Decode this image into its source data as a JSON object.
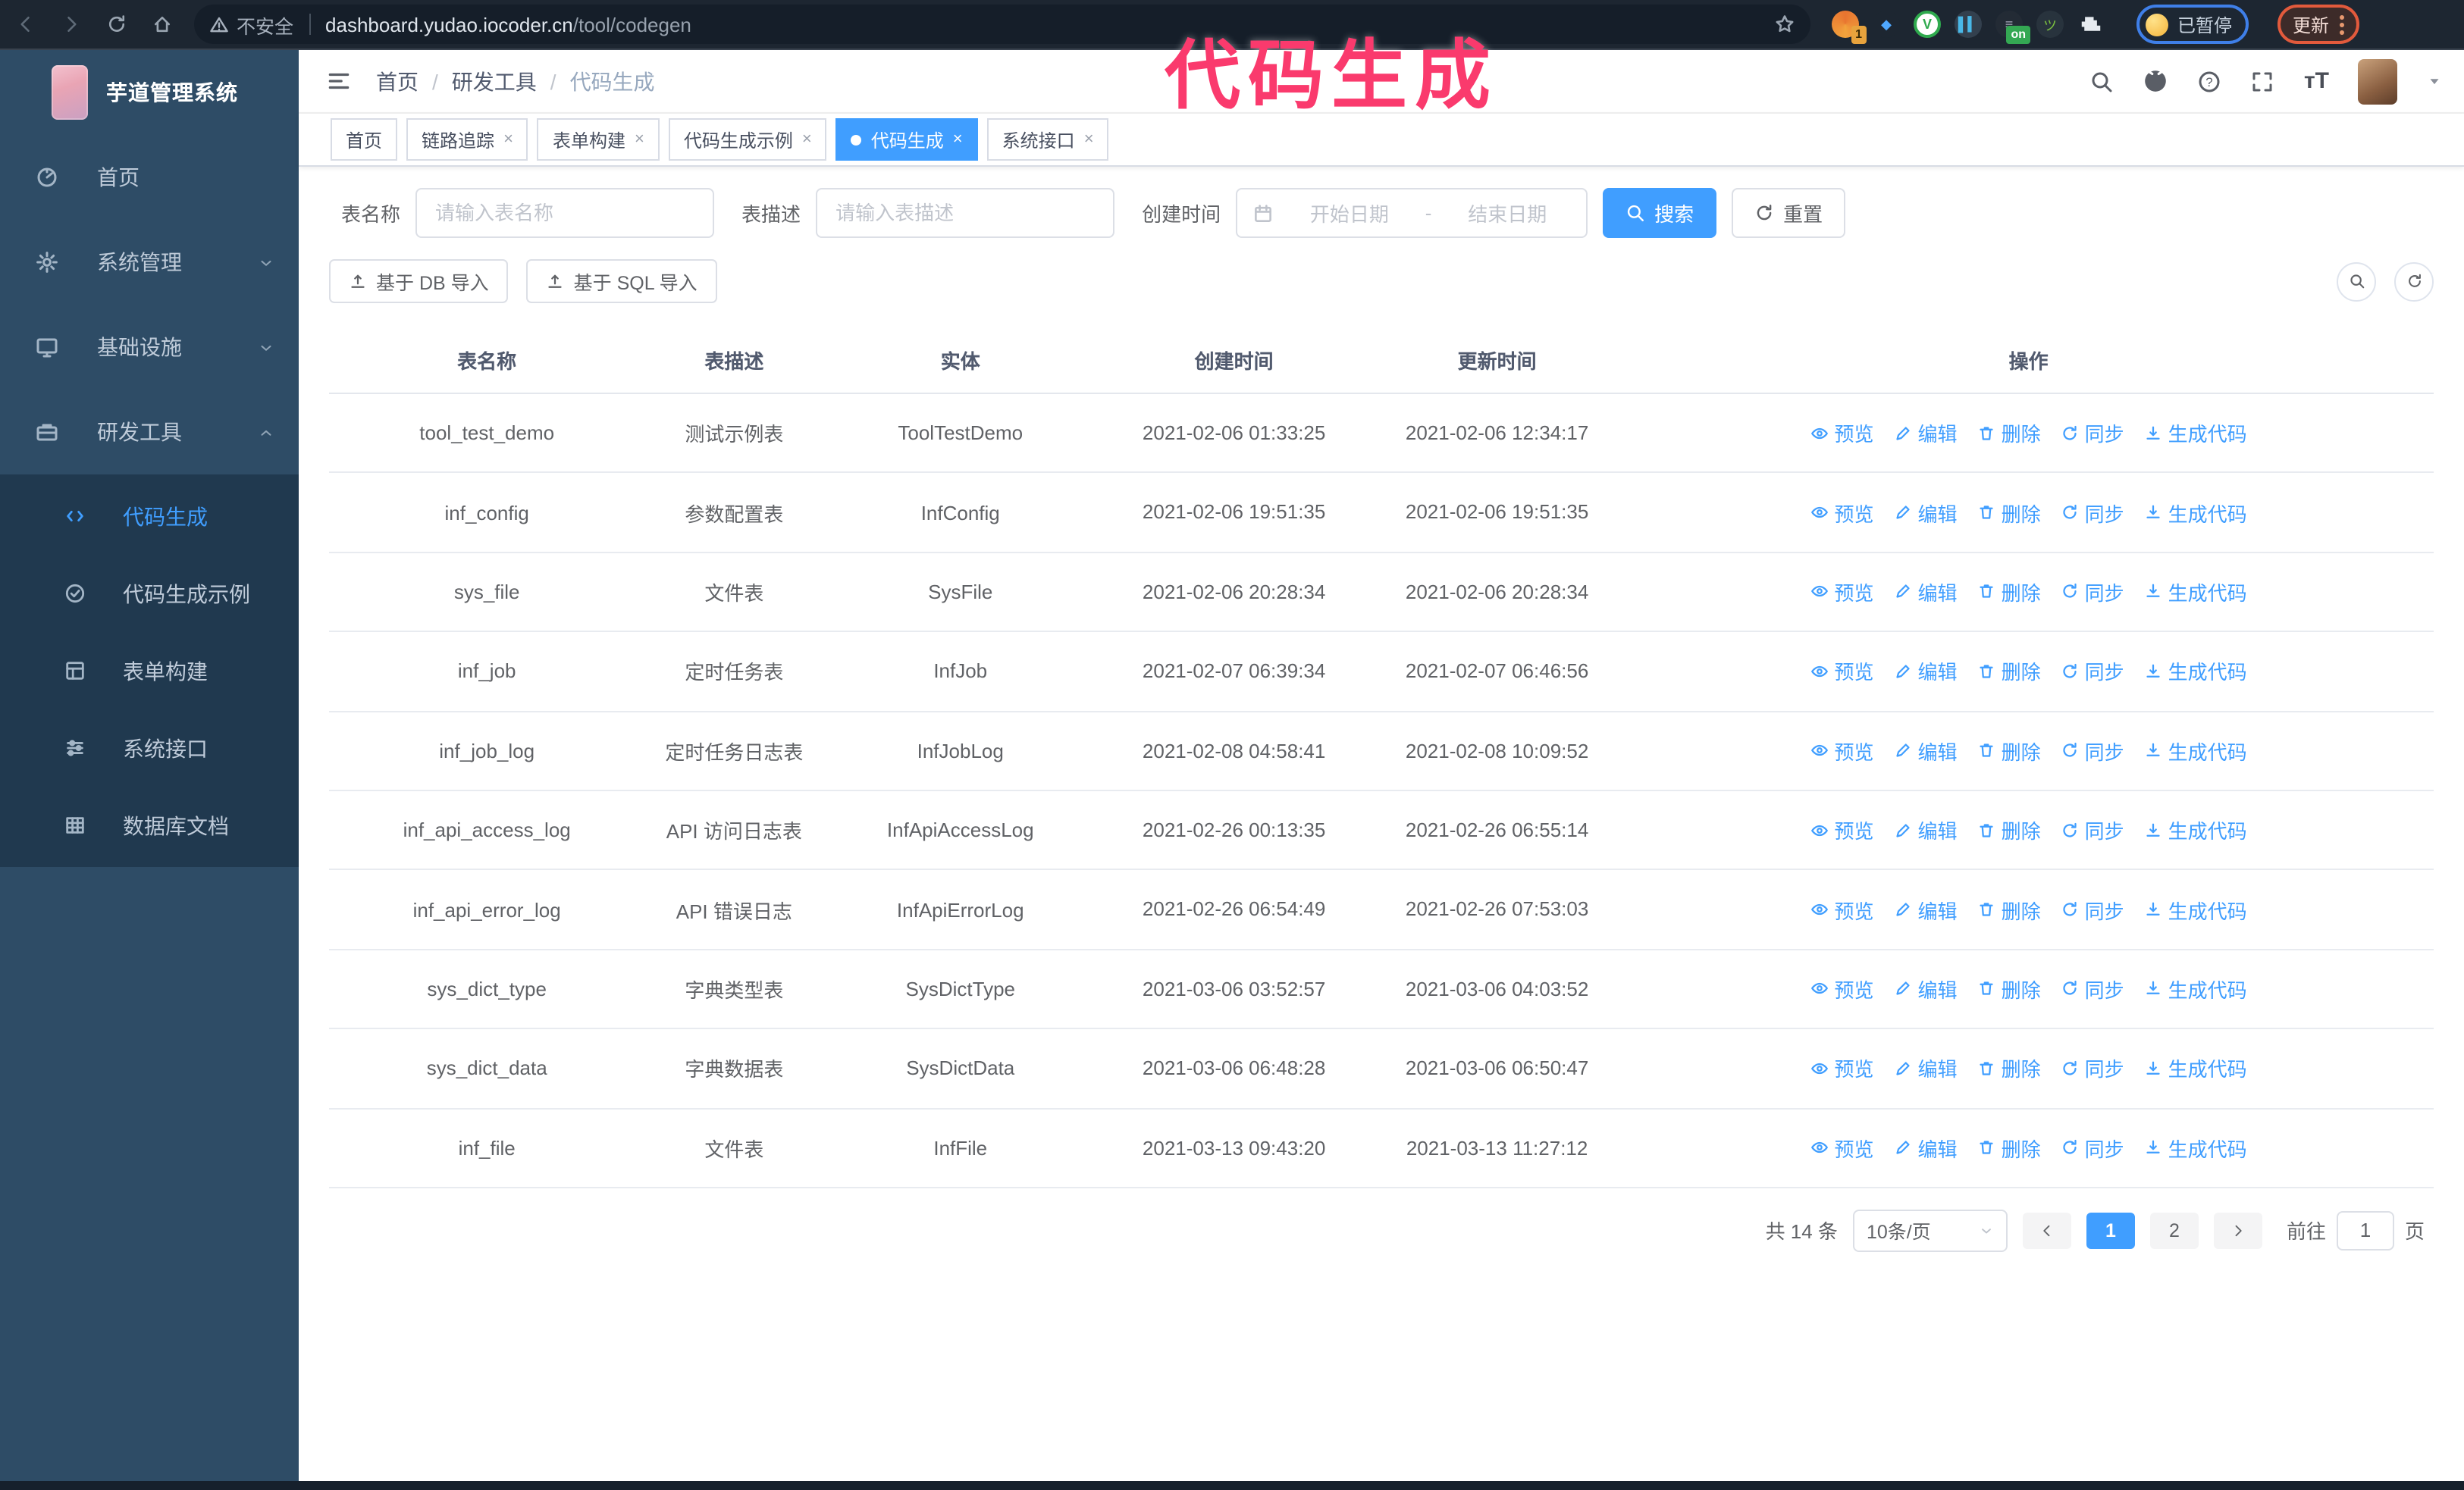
{
  "browser": {
    "security_label": "不安全",
    "url_domain": "dashboard.yudao.iocoder.cn",
    "url_path": "/tool/codegen",
    "extension_badge": "1",
    "extension_on_badge": "on",
    "paused_badge": "已暂停",
    "update_button": "更新"
  },
  "annotation": {
    "text": "代码生成",
    "color": "#fa3a6d"
  },
  "sidebar": {
    "logo_title": "芋道管理系统",
    "items": [
      {
        "label": "首页",
        "icon": "dashboard-icon",
        "chevron": ""
      },
      {
        "label": "系统管理",
        "icon": "gear-icon",
        "chevron": "down"
      },
      {
        "label": "基础设施",
        "icon": "monitor-icon",
        "chevron": "down"
      },
      {
        "label": "研发工具",
        "icon": "toolbox-icon",
        "chevron": "up"
      }
    ],
    "submenu": [
      {
        "label": "代码生成",
        "icon": "code-icon",
        "active": true
      },
      {
        "label": "代码生成示例",
        "icon": "check-circle-icon",
        "active": false
      },
      {
        "label": "表单构建",
        "icon": "form-icon",
        "active": false
      },
      {
        "label": "系统接口",
        "icon": "sliders-icon",
        "active": false
      },
      {
        "label": "数据库文档",
        "icon": "database-doc-icon",
        "active": false
      }
    ]
  },
  "header": {
    "breadcrumb": [
      "首页",
      "研发工具",
      "代码生成"
    ]
  },
  "tabs": [
    {
      "label": "首页",
      "closable": false,
      "active": false
    },
    {
      "label": "链路追踪",
      "closable": true,
      "active": false
    },
    {
      "label": "表单构建",
      "closable": true,
      "active": false
    },
    {
      "label": "代码生成示例",
      "closable": true,
      "active": false
    },
    {
      "label": "代码生成",
      "closable": true,
      "active": true
    },
    {
      "label": "系统接口",
      "closable": true,
      "active": false
    }
  ],
  "filters": {
    "table_name_label": "表名称",
    "table_name_placeholder": "请输入表名称",
    "table_desc_label": "表描述",
    "table_desc_placeholder": "请输入表描述",
    "create_time_label": "创建时间",
    "date_start_placeholder": "开始日期",
    "date_separator": "-",
    "date_end_placeholder": "结束日期",
    "search_button": "搜索",
    "reset_button": "重置"
  },
  "toolbar": {
    "import_db_button": "基于 DB 导入",
    "import_sql_button": "基于 SQL 导入"
  },
  "table": {
    "columns": [
      "表名称",
      "表描述",
      "实体",
      "创建时间",
      "更新时间",
      "操作"
    ],
    "actions": [
      "预览",
      "编辑",
      "删除",
      "同步",
      "生成代码"
    ],
    "rows": [
      {
        "name": "tool_test_demo",
        "desc": "测试示例表",
        "entity": "ToolTestDemo",
        "create_time": "2021-02-06 01:33:25",
        "update_time": "2021-02-06 12:34:17"
      },
      {
        "name": "inf_config",
        "desc": "参数配置表",
        "entity": "InfConfig",
        "create_time": "2021-02-06 19:51:35",
        "update_time": "2021-02-06 19:51:35"
      },
      {
        "name": "sys_file",
        "desc": "文件表",
        "entity": "SysFile",
        "create_time": "2021-02-06 20:28:34",
        "update_time": "2021-02-06 20:28:34"
      },
      {
        "name": "inf_job",
        "desc": "定时任务表",
        "entity": "InfJob",
        "create_time": "2021-02-07 06:39:34",
        "update_time": "2021-02-07 06:46:56"
      },
      {
        "name": "inf_job_log",
        "desc": "定时任务日志表",
        "entity": "InfJobLog",
        "create_time": "2021-02-08 04:58:41",
        "update_time": "2021-02-08 10:09:52"
      },
      {
        "name": "inf_api_access_log",
        "desc": "API 访问日志表",
        "entity": "InfApiAccessLog",
        "create_time": "2021-02-26 00:13:35",
        "update_time": "2021-02-26 06:55:14"
      },
      {
        "name": "inf_api_error_log",
        "desc": "API 错误日志",
        "entity": "InfApiErrorLog",
        "create_time": "2021-02-26 06:54:49",
        "update_time": "2021-02-26 07:53:03"
      },
      {
        "name": "sys_dict_type",
        "desc": "字典类型表",
        "entity": "SysDictType",
        "create_time": "2021-03-06 03:52:57",
        "update_time": "2021-03-06 04:03:52"
      },
      {
        "name": "sys_dict_data",
        "desc": "字典数据表",
        "entity": "SysDictData",
        "create_time": "2021-03-06 06:48:28",
        "update_time": "2021-03-06 06:50:47"
      },
      {
        "name": "inf_file",
        "desc": "文件表",
        "entity": "InfFile",
        "create_time": "2021-03-13 09:43:20",
        "update_time": "2021-03-13 11:27:12"
      }
    ]
  },
  "pagination": {
    "total": "共 14 条",
    "page_size": "10条/页",
    "pages": [
      "1",
      "2"
    ],
    "active_page": "1",
    "goto_label": "前往",
    "goto_value": "1",
    "goto_suffix": "页"
  },
  "colors": {
    "accent": "#409eff",
    "sidebar_bg": "#2e4c66",
    "submenu_bg": "#20394f",
    "chrome_bg": "#1d2631",
    "annotation_pink": "#fa3a6d"
  }
}
